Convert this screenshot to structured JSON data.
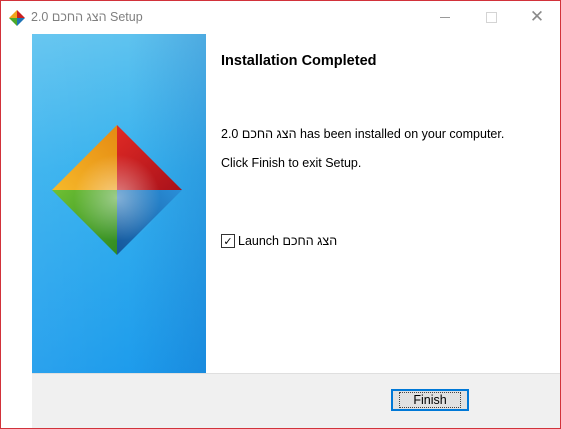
{
  "window": {
    "title": "הצג החכם 2.0 Setup",
    "controls": {
      "minimize_icon": "minimize-icon",
      "maximize_icon": "maximize-icon",
      "close_icon": "close-icon"
    },
    "border_color": "#d2323a"
  },
  "content": {
    "heading": "Installation Completed",
    "installed_message": "הצג החכם 2.0 has been installed on your computer.",
    "exit_instruction": "Click Finish to exit Setup."
  },
  "launch_option": {
    "checked": true,
    "label": "Launch הצג החכם"
  },
  "buttons": {
    "finish_label": "Finish"
  },
  "colors": {
    "side_panel_top": "#5fc3ef",
    "side_panel_bottom": "#1e9cec",
    "button_focus": "#0078d7",
    "diamond_top_left": "#f1a51d",
    "diamond_top_right": "#cc2020",
    "diamond_bottom_left": "#4caa2a",
    "diamond_bottom_right": "#1e74b5"
  }
}
